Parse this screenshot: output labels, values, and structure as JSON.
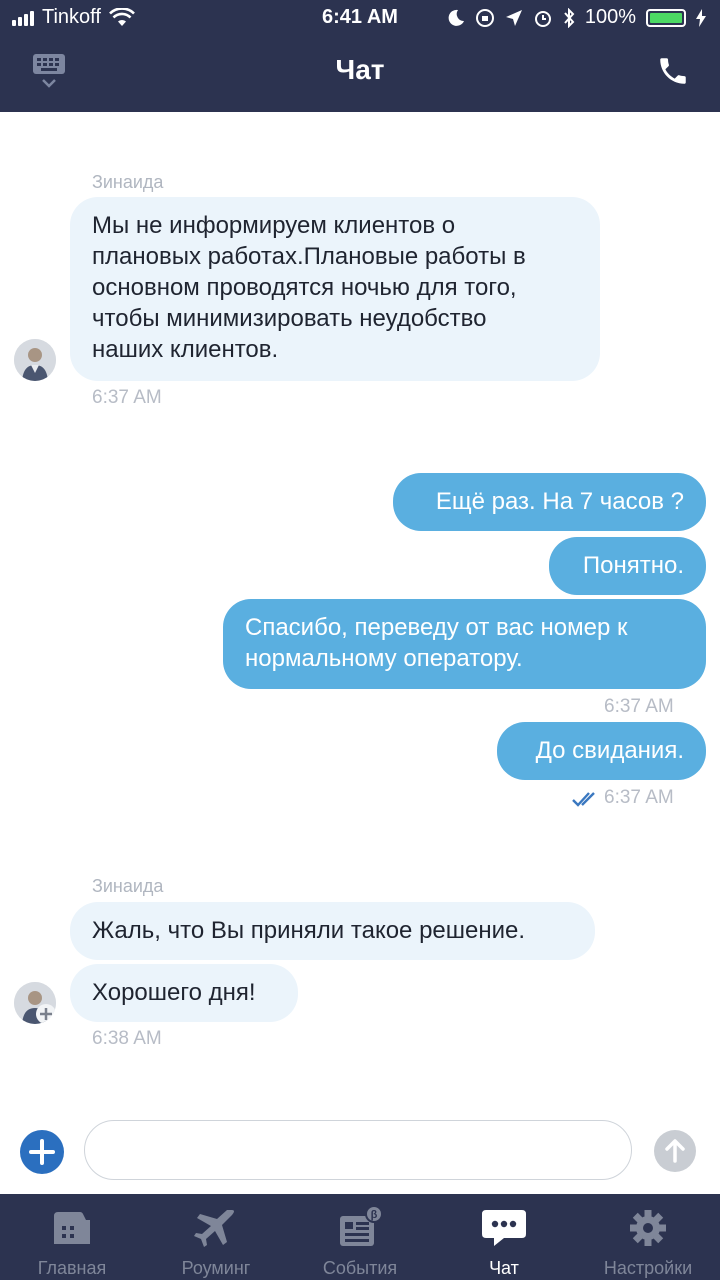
{
  "status_bar": {
    "carrier": "Tinkoff",
    "time": "6:41 AM",
    "battery": "100%"
  },
  "header": {
    "title": "Чат"
  },
  "messages": {
    "group1": {
      "sender": "Зинаида",
      "text_lines": [
        "Мы не информируем клиентов о",
        "плановых работах.Плановые работы в",
        "основном проводятся ночью для того,",
        "чтобы минимизировать неудобство",
        "наших клиентов."
      ],
      "time": "6:37 AM"
    },
    "outgoing": {
      "msg1": "Ещё раз. На 7 часов ?",
      "msg2": "Понятно.",
      "msg3_lines": [
        "Спасибо, переведу от вас номер к",
        "нормальному оператору."
      ],
      "time1": "6:37 AM",
      "msg4": "До свидания.",
      "time2": "6:37 AM"
    },
    "group2": {
      "sender": "Зинаида",
      "msg1": "Жаль, что Вы приняли такое решение.",
      "msg2": "Хорошего дня!",
      "time": "6:38 AM"
    }
  },
  "input": {
    "placeholder": ""
  },
  "tabs": [
    {
      "label": "Главная",
      "icon": "wallet-icon"
    },
    {
      "label": "Роуминг",
      "icon": "airplane-icon"
    },
    {
      "label": "События",
      "icon": "news-icon"
    },
    {
      "label": "Чат",
      "icon": "chat-icon"
    },
    {
      "label": "Настройки",
      "icon": "gear-icon"
    }
  ],
  "colors": {
    "header_bg": "#2c3350",
    "incoming_bubble": "#ebf4fb",
    "outgoing_bubble": "#5aafe0",
    "accent": "#2b6fbf"
  }
}
